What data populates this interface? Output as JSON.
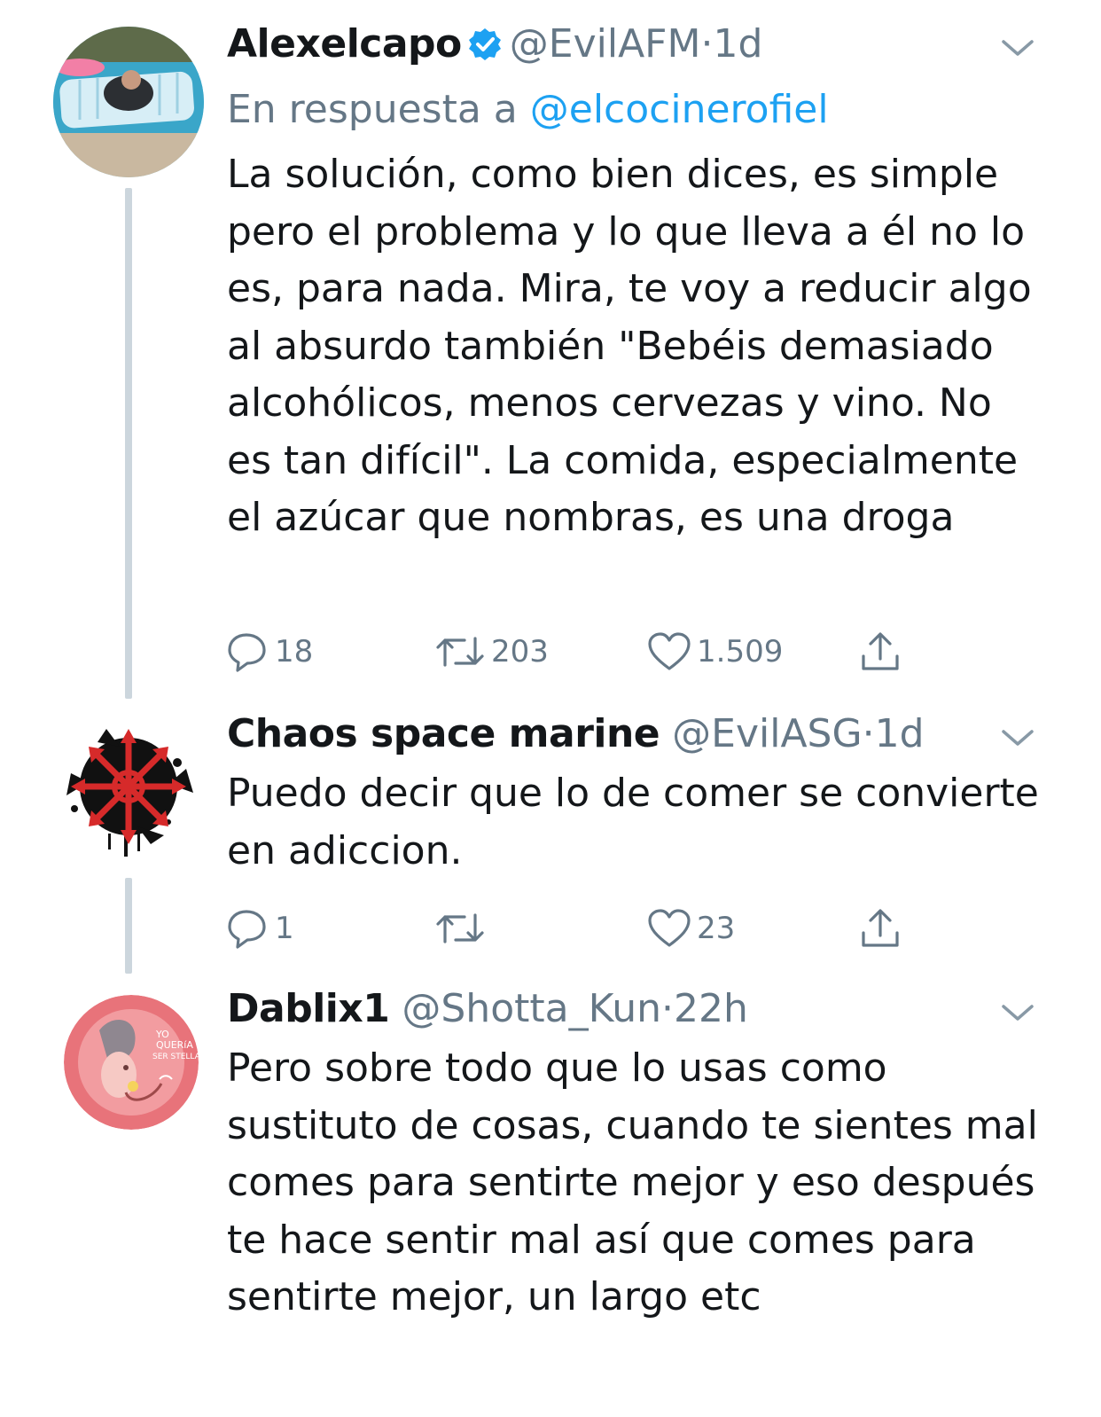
{
  "tweets": [
    {
      "name": "Alexelcapo",
      "handle": "@EvilAFM",
      "separator": "·",
      "time": "1d",
      "reply_prefix": "En respuesta a",
      "reply_mention": "@elcocinerofiel",
      "text": "La solución, como bien dices, es simple pero el problema y lo que lleva a él no lo es, para nada. Mira, te voy a reducir algo al absurdo también \"Bebéis demasiado alcohólicos, menos cervezas y vino. No es tan difícil\". La comida, especialmente el azúcar que nombras, es una droga",
      "replies": "18",
      "retweets": "203",
      "likes": "1.509"
    },
    {
      "name": "Chaos space marine",
      "handle": "@EvilASG",
      "separator": "·",
      "time": "1d",
      "text": "Puedo decir que lo de comer se convierte en adiccion.",
      "replies": "1",
      "retweets": "",
      "likes": "23"
    },
    {
      "name": "Dablix1",
      "handle": "@Shotta_Kun",
      "separator": "·",
      "time": "22h",
      "avatar_text": [
        "YO",
        "QUERíA",
        "SER STELLA"
      ],
      "text": "Pero sobre todo que lo usas como sustituto de cosas, cuando te sientes mal comes para sentirte mejor y eso después te hace sentir mal así que comes para sentirte mejor, un largo etc"
    }
  ],
  "icons": {
    "verified": "verified-badge-icon",
    "caret": "chevron-down-icon",
    "reply": "reply-bubble-icon",
    "retweet": "retweet-icon",
    "like": "heart-icon",
    "share": "share-icon"
  },
  "colors": {
    "text": "#14171a",
    "secondary": "#657786",
    "link": "#1da1f2",
    "thread_line": "#ccd6dd"
  }
}
